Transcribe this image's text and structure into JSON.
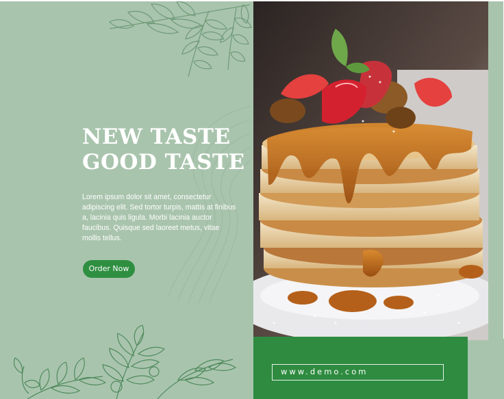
{
  "hero": {
    "headline_line1": "NEW TASTE",
    "headline_line2": "GOOD TASTE",
    "body": "Lorem ipsum dolor sit amet, consectetur adipiscing elit. Sed tortor turpis, mattis at finibus a, lacinia quis ligula. Morbi lacinia auctor faucibus. Quisque sed laoreet metus, vitae mollis tellus.",
    "cta_label": "Order Now"
  },
  "footer": {
    "url": "www.demo.com"
  },
  "colors": {
    "sage_background": "#a9c4ad",
    "brand_green": "#2e8b40",
    "text_white": "#ffffff"
  },
  "icons": {
    "top_decoration": "leaf-branch-icon",
    "bottom_decoration": "leaf-branch-icon",
    "photo": "pancake-stack-photo"
  }
}
